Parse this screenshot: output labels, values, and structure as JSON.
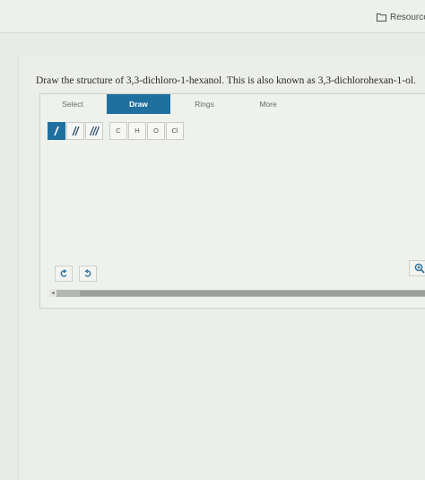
{
  "header": {
    "resources_label": "Resources",
    "resources_icon": "folder-icon"
  },
  "question": {
    "text": "Draw the structure of 3,3-dichloro-1-hexanol. This is also known as 3,3-dichlorohexan-1-ol."
  },
  "editor": {
    "tabs": [
      {
        "label": "Select",
        "active": false
      },
      {
        "label": "Draw",
        "active": true
      },
      {
        "label": "Rings",
        "active": false
      },
      {
        "label": "More",
        "active": false
      }
    ],
    "bond_tools": [
      {
        "name": "single-bond",
        "active": true
      },
      {
        "name": "double-bond",
        "active": false
      },
      {
        "name": "triple-bond",
        "active": false
      }
    ],
    "atoms": [
      "C",
      "H",
      "O",
      "Cl"
    ],
    "undo_icon": "undo-icon",
    "redo_icon": "redo-icon",
    "zoom_icon": "zoom-in-icon",
    "accent_color": "#1f6f9f",
    "scroll_left_glyph": "◂"
  }
}
